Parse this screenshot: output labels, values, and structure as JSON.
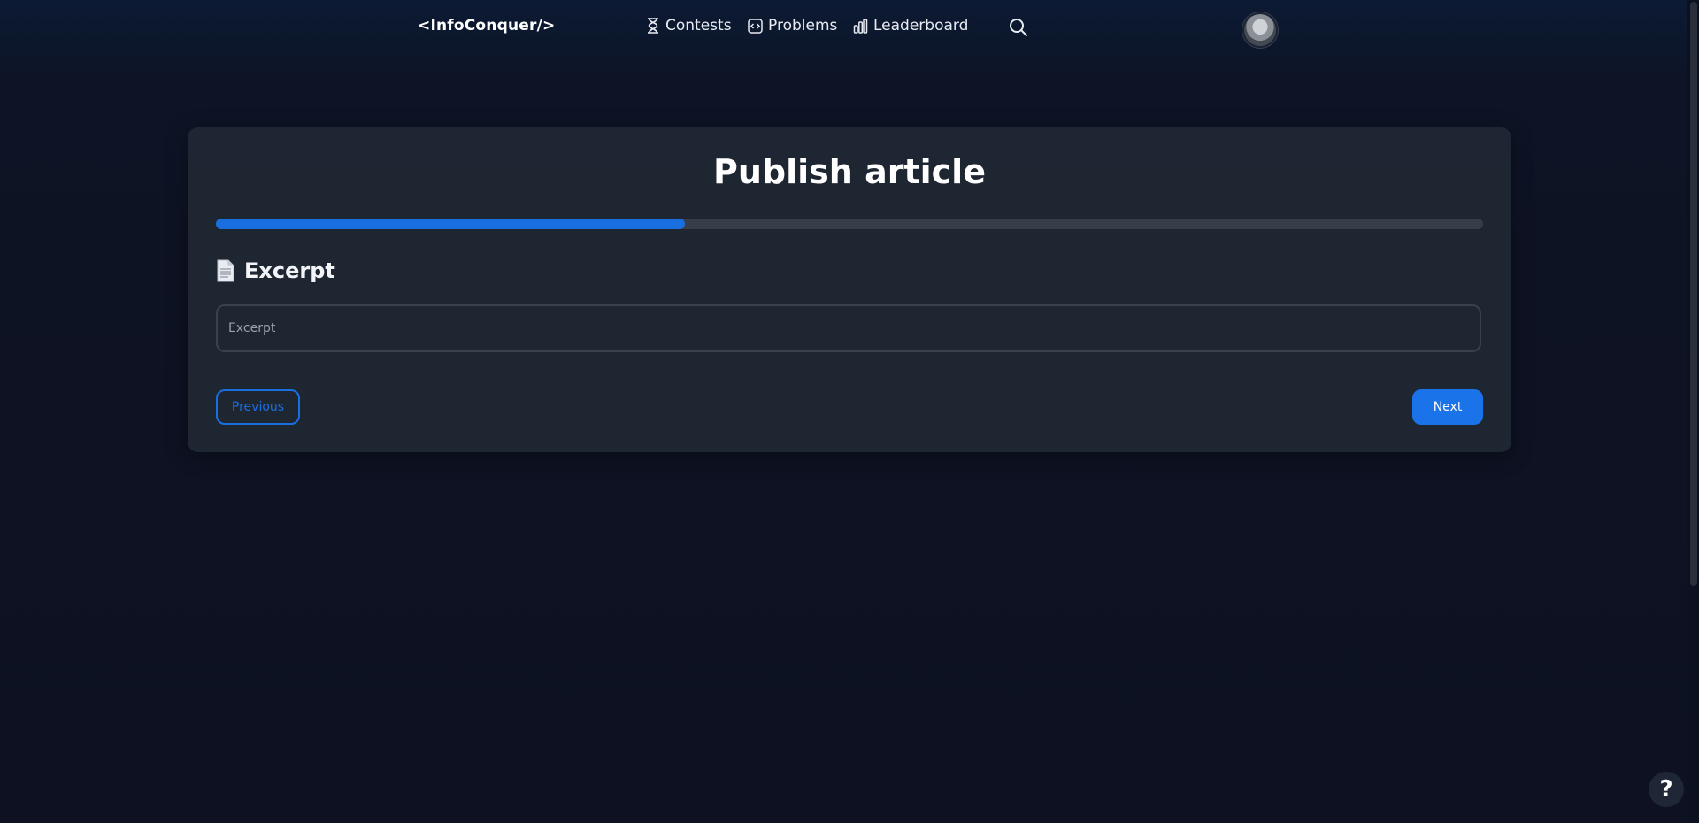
{
  "navbar": {
    "brand": "<InfoConquer/>",
    "items": [
      {
        "label": "Contests",
        "icon": "hourglass-icon"
      },
      {
        "label": "Problems",
        "icon": "code-box-icon"
      },
      {
        "label": "Leaderboard",
        "icon": "bar-chart-icon"
      }
    ],
    "search_icon": "search-icon",
    "avatar_icon": "user-avatar"
  },
  "form": {
    "title": "Publish article",
    "progress_percent": 37,
    "section_icon": "document-icon",
    "section_label": "Excerpt",
    "excerpt": {
      "value": "",
      "placeholder": "Excerpt"
    },
    "previous_label": "Previous",
    "next_label": "Next"
  },
  "help": {
    "label": "?"
  },
  "colors": {
    "accent": "#1a73e8",
    "background": "#0d1222",
    "card": "#202834"
  }
}
